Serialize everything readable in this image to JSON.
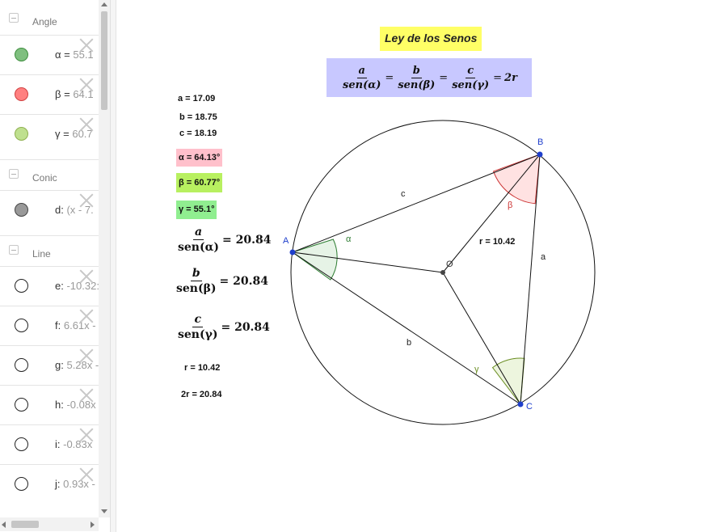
{
  "algebra": {
    "groups": [
      {
        "name": "Angle"
      },
      {
        "name": "Conic"
      },
      {
        "name": "Line"
      }
    ],
    "items": [
      {
        "expr_name": "α =",
        "expr_value": "55.1",
        "color": "#7fbf7f",
        "border": "#3f8f3f",
        "filled": true
      },
      {
        "expr_name": "β =",
        "expr_value": "64.1",
        "color": "#ff8080",
        "border": "#d04040",
        "filled": true
      },
      {
        "expr_name": "γ =",
        "expr_value": "60.7",
        "color": "#bfe08f",
        "border": "#8fb050",
        "filled": true
      },
      {
        "expr_name": "d:",
        "expr_value": "(x - 7.",
        "color": "#999999",
        "border": "#444444",
        "filled": true
      },
      {
        "expr_name": "e:",
        "expr_value": "-10.32:",
        "color": "#ffffff",
        "border": "#222222",
        "filled": false
      },
      {
        "expr_name": "f:",
        "expr_value": "6.61x -",
        "color": "#ffffff",
        "border": "#222222",
        "filled": false
      },
      {
        "expr_name": "g:",
        "expr_value": "5.28x -",
        "color": "#ffffff",
        "border": "#222222",
        "filled": false
      },
      {
        "expr_name": "h:",
        "expr_value": "-0.08x",
        "color": "#ffffff",
        "border": "#222222",
        "filled": false
      },
      {
        "expr_name": "i:",
        "expr_value": "-0.83x",
        "color": "#ffffff",
        "border": "#222222",
        "filled": false
      },
      {
        "expr_name": "j:",
        "expr_value": "0.93x -",
        "color": "#ffffff",
        "border": "#222222",
        "filled": false
      }
    ]
  },
  "graphics": {
    "title": "Ley de los Senos",
    "formula": {
      "n1": "a",
      "d1": "sen(α)",
      "n2": "b",
      "d2": "sen(β)",
      "n3": "c",
      "d3": "sen(γ)",
      "eq": "=",
      "rhs": "2r"
    },
    "values": {
      "a": "a = 17.09",
      "b": "b = 18.75",
      "c": "c = 18.19",
      "alpha": "α = 64.13°",
      "beta": "β = 60.77°",
      "gamma": "γ = 55.1°",
      "r": "r = 10.42",
      "two_r": "2r = 20.84"
    },
    "ratios": [
      {
        "num": "a",
        "den": "sen(α)",
        "val": "= 20.84"
      },
      {
        "num": "b",
        "den": "sen(β)",
        "val": "= 20.84"
      },
      {
        "num": "c",
        "den": "sen(γ)",
        "val": "= 20.84"
      }
    ],
    "colors": {
      "alpha_box": "#ffc0cb",
      "beta_box": "#b8f060",
      "gamma_box": "#90ee90",
      "title_bg": "#ffff66",
      "formula_bg": "#c8c8ff",
      "point": "#1f3fcc"
    },
    "labels": {
      "A": "A",
      "B": "B",
      "C": "C",
      "O": "O",
      "side_a": "a",
      "side_b": "b",
      "side_c": "c",
      "ang_alpha": "α",
      "ang_beta": "β",
      "ang_gamma": "γ",
      "radius": "r = 10.42"
    }
  }
}
